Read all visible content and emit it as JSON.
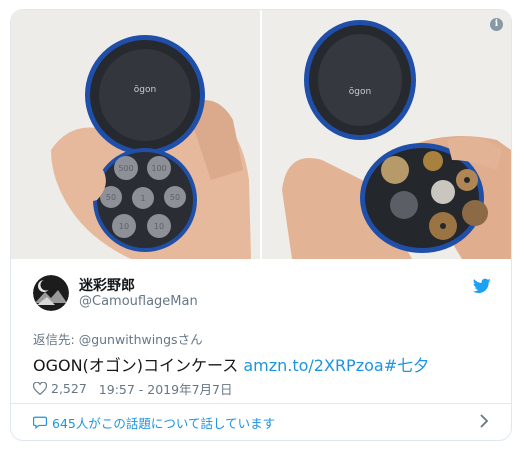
{
  "media": {
    "left_photo": {
      "case_brand": "ōgon",
      "coin_labels": [
        "500",
        "100",
        "50",
        "1",
        "50",
        "10",
        "10"
      ]
    },
    "right_photo": {
      "case_brand": "ōgon"
    },
    "info_icon": "i"
  },
  "author": {
    "display_name": "迷彩野郎",
    "handle": "@CamouflageMan"
  },
  "reply": {
    "prefix": "返信先: ",
    "handle": "@gunwithwings",
    "suffix": "さん"
  },
  "tweet": {
    "text": "OGON(オゴン)コインケース ",
    "link": "amzn.to/2XRPzoa",
    "hashtag": "#七夕"
  },
  "meta": {
    "likes": "2,527",
    "timestamp": "19:57 - 2019年7月7日"
  },
  "conversation": {
    "label": "645人がこの話題について話しています"
  },
  "colors": {
    "link": "#1b95e0",
    "twitter_blue": "#1da1f2",
    "muted": "#657786",
    "border": "#e1e8ed"
  },
  "icons": {
    "bird": "twitter-bird-icon",
    "heart": "heart-icon",
    "bubble": "speech-bubble-icon",
    "chevron": "chevron-right-icon"
  }
}
